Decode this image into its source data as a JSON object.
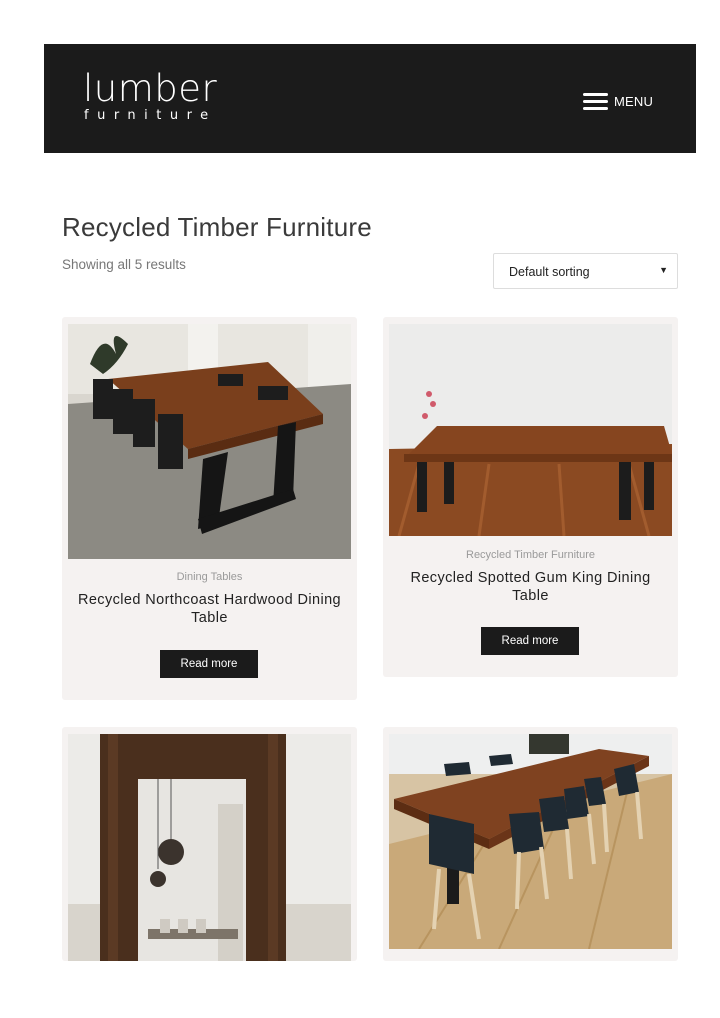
{
  "header": {
    "logo_main": "lumber",
    "logo_sub": "furniture",
    "menu_label": "MENU"
  },
  "page": {
    "title": "Recycled Timber Furniture",
    "results_count": "Showing all 5 results"
  },
  "sorting": {
    "selected": "Default sorting"
  },
  "products": [
    {
      "category": "Dining Tables",
      "title": "Recycled Northcoast Hardwood Dining Table",
      "button": "Read more"
    },
    {
      "category": "Recycled Timber Furniture",
      "title": "Recycled Spotted Gum King Dining Table",
      "button": "Read more"
    },
    {
      "category": "",
      "title": "",
      "button": ""
    },
    {
      "category": "",
      "title": "",
      "button": ""
    }
  ],
  "colors": {
    "header_bg": "#1b1b1b",
    "card_bg": "#f5f2f1",
    "button_bg": "#1b1b1b"
  },
  "icons": {
    "menu": "hamburger-icon",
    "sort_caret": "caret-down-icon"
  }
}
